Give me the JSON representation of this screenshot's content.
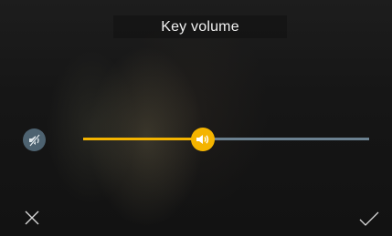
{
  "header": {
    "title": "Key volume"
  },
  "volume": {
    "level": 0.42
  },
  "colors": {
    "accent": "#f4b400",
    "track": "#6b8190",
    "mute_button": "#4d6270"
  },
  "icons": {
    "mute": "speaker-muted-icon",
    "volume": "speaker-icon",
    "cancel": "close-icon",
    "confirm": "checkmark-icon"
  }
}
